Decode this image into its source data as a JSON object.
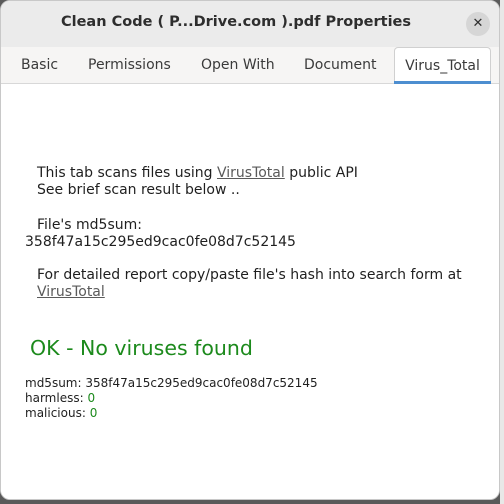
{
  "window": {
    "title": "Clean Code ( P...Drive.com ).pdf Properties",
    "close_glyph": "✕"
  },
  "tabs": [
    {
      "label": "Basic"
    },
    {
      "label": "Permissions"
    },
    {
      "label": "Open With"
    },
    {
      "label": "Document"
    },
    {
      "label": "Virus_Total",
      "active": true
    }
  ],
  "intro": {
    "line1_prefix": "This tab scans files using ",
    "line1_link": "VirusTotal",
    "line1_suffix": " public API",
    "line2": "See brief scan result below .."
  },
  "md5": {
    "label": "File's md5sum:",
    "value": "358f47a15c295ed9cac0fe08d7c52145"
  },
  "report": {
    "text": "For detailed report copy/paste file's hash into search form at",
    "link": "VirusTotal"
  },
  "result": {
    "status": "OK - No viruses found",
    "md5_line": "md5sum: 358f47a15c295ed9cac0fe08d7c52145",
    "harmless_label": "harmless: ",
    "harmless_value": "0",
    "malicious_label": "malicious: ",
    "malicious_value": "0"
  },
  "colors": {
    "ok_green": "#1c8a1c",
    "tab_accent": "#4d8ed0"
  }
}
